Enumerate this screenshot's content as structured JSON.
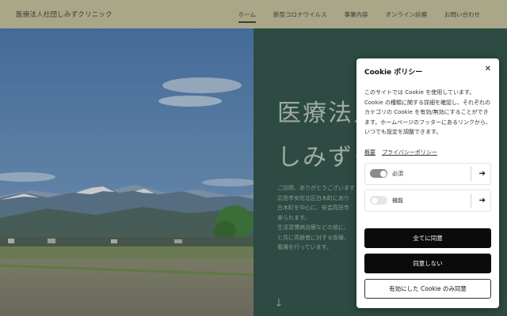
{
  "header": {
    "brand": "医療法人社団しみずクリニック",
    "nav": [
      {
        "label": "ホーム",
        "active": true
      },
      {
        "label": "新型コロナウイルス",
        "active": false
      },
      {
        "label": "事業内容",
        "active": false
      },
      {
        "label": "オンライン診療",
        "active": false
      },
      {
        "label": "お問い合わせ",
        "active": false
      }
    ]
  },
  "hero": {
    "title_line1": "医療法人",
    "title_line2": "しみずク",
    "body_lines": [
      "ご訪問、ありがとうございます",
      "広島市安佐北区白木町にあり",
      "白木町を中心に、安芸高田市",
      "来られます。",
      "生活習慣病治療などの他に、",
      "と共に高齢者に対する医療、",
      "看護を行っています。"
    ],
    "scroll_icon": "arrow-down-icon"
  },
  "cookie": {
    "title": "Cookie ポリシー",
    "close_icon": "close-icon",
    "description": "このサイトでは Cookie を使用しています。Cookie の種類に関する詳細を確認し、それぞれのカテゴリの Cookie を有効/無効にすることができます。ホームページのフッターにあるリンクから、いつでも設定を調整できます。",
    "links": [
      "概要",
      "プライバシーポリシー"
    ],
    "categories": [
      {
        "label": "必須",
        "enabled": true
      },
      {
        "label": "機能",
        "enabled": false
      }
    ],
    "buttons": {
      "accept_all": "全てに同意",
      "reject": "同意しない",
      "accept_selected": "有効にした Cookie のみ同意"
    }
  }
}
